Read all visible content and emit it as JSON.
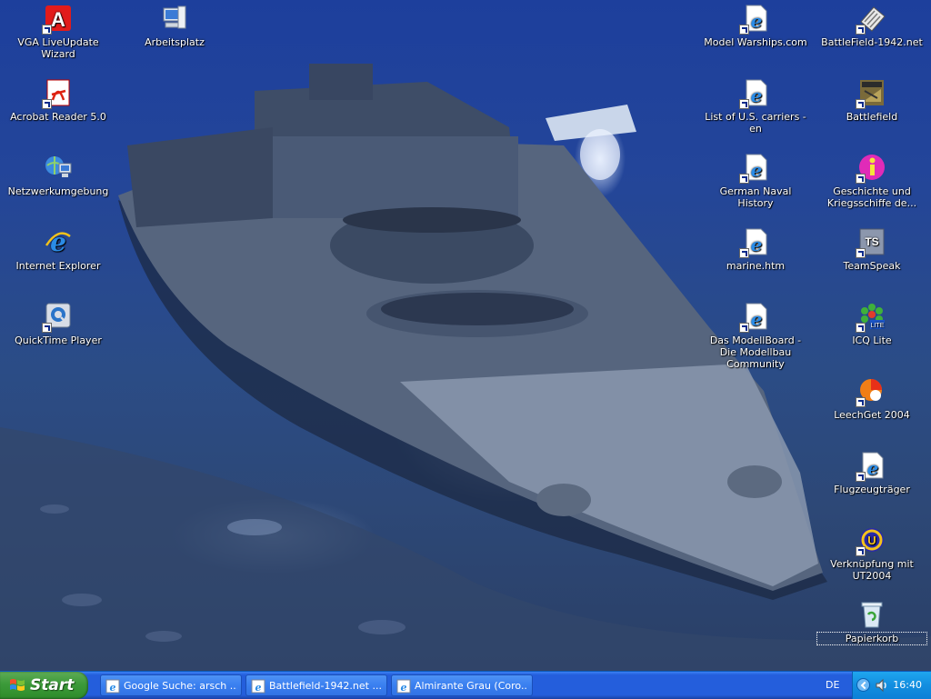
{
  "wallpaper": {
    "subject": "sunken-battleship-wreck",
    "tint": "#23459a"
  },
  "desktop_icons_left": [
    {
      "label": "VGA LiveUpdate Wizard",
      "icon": "vga-liveupdate-icon",
      "shortcut": true
    },
    {
      "label": "Arbeitsplatz",
      "icon": "my-computer-icon",
      "shortcut": false
    },
    {
      "label": "Acrobat Reader 5.0",
      "icon": "acrobat-icon",
      "shortcut": true
    },
    {
      "label": "Netzwerkumgebung",
      "icon": "network-icon",
      "shortcut": false
    },
    {
      "label": "Internet Explorer",
      "icon": "internet-explorer-icon",
      "shortcut": false
    },
    {
      "label": "QuickTime Player",
      "icon": "quicktime-icon",
      "shortcut": true
    }
  ],
  "desktop_icons_right": [
    {
      "label": "Model Warships.com",
      "icon": "ie-link-icon",
      "shortcut": true
    },
    {
      "label": "BattleField-1942.net",
      "icon": "battlefield-net-icon",
      "shortcut": true
    },
    {
      "label": "List of U.S. carriers - en",
      "icon": "ie-link-icon",
      "shortcut": true
    },
    {
      "label": "Battlefield",
      "icon": "battlefield-game-icon",
      "shortcut": true
    },
    {
      "label": "German Naval History",
      "icon": "ie-link-icon",
      "shortcut": true
    },
    {
      "label": "Geschichte und Kriegsschiffe de...",
      "icon": "info-icon",
      "shortcut": true
    },
    {
      "label": "marine.htm",
      "icon": "ie-link-icon",
      "shortcut": true
    },
    {
      "label": "TeamSpeak",
      "icon": "teamspeak-icon",
      "shortcut": true
    },
    {
      "label": "Das ModellBoard - Die Modellbau Community",
      "icon": "ie-link-icon",
      "shortcut": true
    },
    {
      "label": "ICQ Lite",
      "icon": "icq-icon",
      "shortcut": true
    },
    {
      "label": "LeechGet 2004",
      "icon": "leechget-icon",
      "shortcut": true
    },
    {
      "label": "Flugzeugträger",
      "icon": "ie-document-icon",
      "shortcut": true
    },
    {
      "label": "Verknüpfung mit UT2004",
      "icon": "ut2004-icon",
      "shortcut": true
    },
    {
      "label": "Papierkorb",
      "icon": "recycle-bin-icon",
      "shortcut": false
    }
  ],
  "taskbar": {
    "start_label": "Start",
    "tasks": [
      {
        "label": "Google Suche: arsch ...",
        "icon": "ie-icon"
      },
      {
        "label": "Battlefield-1942.net ...",
        "icon": "ie-icon"
      },
      {
        "label": "Almirante Grau (Coro...",
        "icon": "ie-icon"
      }
    ],
    "language": "DE",
    "clock": "16:40",
    "colors": {
      "taskbar": "#245edc",
      "start": "#3c9a3a",
      "tray": "#128ee0"
    }
  }
}
